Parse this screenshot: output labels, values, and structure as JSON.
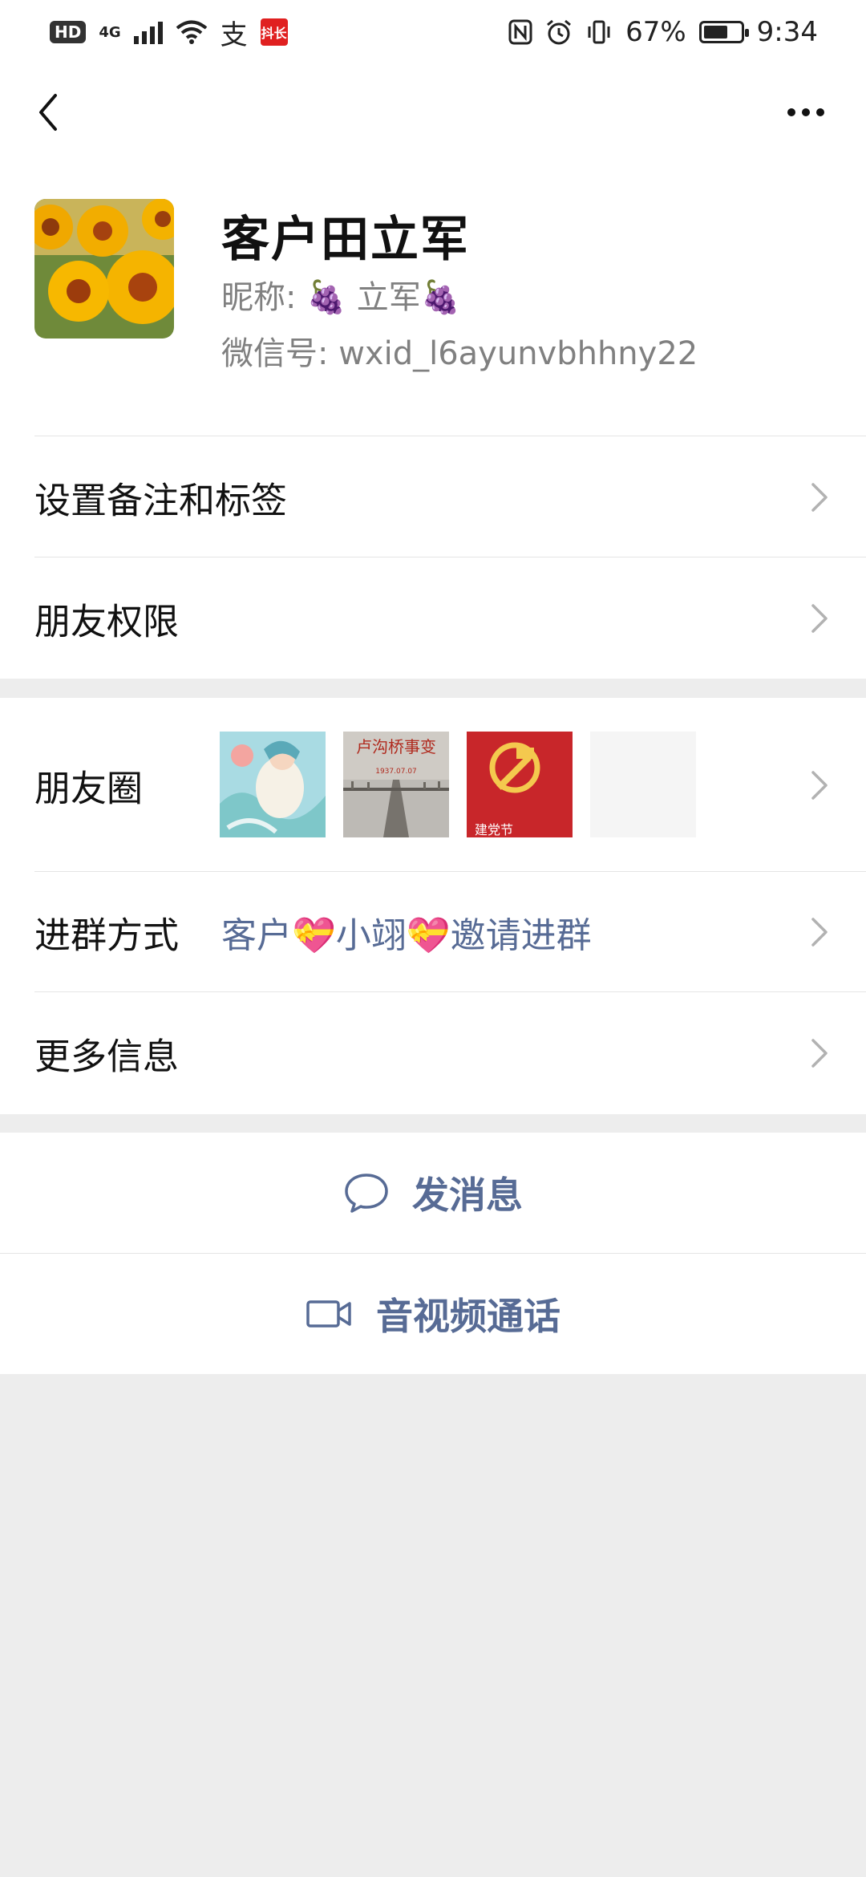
{
  "status_bar": {
    "hd": "HD",
    "network": "4G",
    "alipay_glyph": "支",
    "app_badge": "抖长",
    "battery_percent": "67%",
    "battery_level": 0.67,
    "time": "9:34",
    "icons": [
      "hd-icon",
      "signal-icon",
      "wifi-icon",
      "alipay-icon",
      "app-badge-icon",
      "nfc-icon",
      "alarm-icon",
      "vibrate-icon",
      "battery-icon"
    ]
  },
  "nav": {
    "back_icon": "chevron-left-icon",
    "more_icon": "more-horizontal-icon"
  },
  "profile": {
    "display_name": "客户田立军",
    "nickname_label": "昵称:",
    "nickname_value": "🍇 立军🍇",
    "wechat_id_label": "微信号:",
    "wechat_id_value": "wxid_l6ayunvbhhny22"
  },
  "menu": {
    "remark_tags": "设置备注和标签",
    "friend_permissions": "朋友权限",
    "moments": "朋友圈",
    "moments_thumb_2_text": "卢沟桥事变",
    "moments_thumb_2_date": "1937.07.07",
    "moments_thumb_3_text": "建党节",
    "group_join_label": "进群方式",
    "group_join_value": "客户💝小翊💝邀请进群",
    "more_info": "更多信息"
  },
  "actions": {
    "send_message": "发消息",
    "video_call": "音视频通话"
  },
  "colors": {
    "link_blue": "#576b95",
    "background_gray": "#ededed",
    "divider": "#e5e5e5"
  }
}
